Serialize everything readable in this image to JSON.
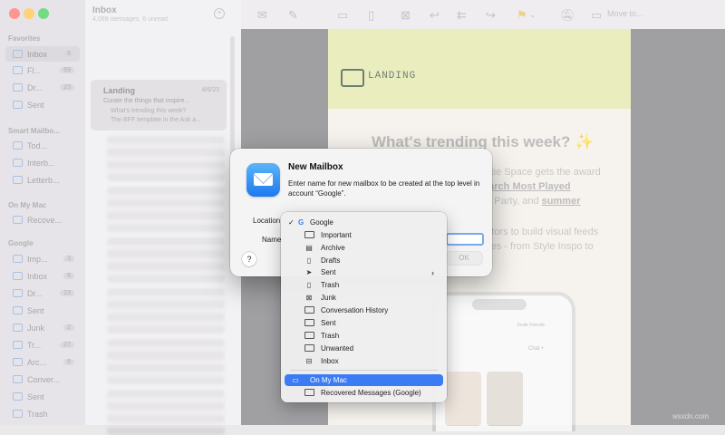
{
  "window": {
    "traffic_colors": [
      "#ff5f57",
      "#febc2e",
      "#28c840"
    ]
  },
  "sidebar": {
    "favorites_label": "Favorites",
    "smart_label": "Smart Mailbo...",
    "onmymac_label": "On My Mac",
    "google_label": "Google",
    "favorites": [
      {
        "label": "Inbox",
        "count": "6"
      },
      {
        "label": "Fl...",
        "count": "69"
      },
      {
        "label": "Dr...",
        "count": "23"
      },
      {
        "label": "Sent",
        "count": ""
      }
    ],
    "smart": [
      {
        "label": "Tod..."
      },
      {
        "label": "Interb..."
      },
      {
        "label": "Letterb..."
      }
    ],
    "onmymac": [
      {
        "label": "Recove..."
      }
    ],
    "google": [
      {
        "label": "Imp...",
        "count": "3"
      },
      {
        "label": "Inbox",
        "count": "6"
      },
      {
        "label": "Dr...",
        "count": "23"
      },
      {
        "label": "Sent",
        "count": ""
      },
      {
        "label": "Junk",
        "count": "2"
      },
      {
        "label": "Tr...",
        "count": "27"
      },
      {
        "label": "Arc...",
        "count": "6"
      },
      {
        "label": "Conver...",
        "count": ""
      },
      {
        "label": "Sent",
        "count": ""
      },
      {
        "label": "Trash",
        "count": ""
      }
    ]
  },
  "message_list": {
    "title": "Inbox",
    "subtitle": "4,069 messages, 6 unread",
    "selected": {
      "sender": "Landing",
      "date": "4/6/23",
      "subject": "Curate the things that inspire...",
      "preview1": "What's trending this week?",
      "preview2": "The BFF template in the Ask a..."
    }
  },
  "toolbar": {
    "move_to": "Move to..."
  },
  "email": {
    "brand": "LANDING",
    "headline": "What's trending this week? ✨",
    "body1a": "estie Space gets the award",
    "body1b": "March Most Played",
    "body1c": "ng Party, and ",
    "body1d": "summer",
    "body2a": "eators to build visual feeds",
    "body2b": "ches - from Style Inspo to",
    "phone_invite": "Invite Friends",
    "phone_chat": "Chat •",
    "banner_color": "#dfe49a"
  },
  "dialog": {
    "title": "New Mailbox",
    "message": "Enter name for new mailbox to be created at the top level in account “Google”.",
    "location_label": "Location",
    "name_label": "Name",
    "name_value": "",
    "ok_label": "OK",
    "help_label": "?"
  },
  "location_menu": {
    "account": "Google",
    "items": [
      {
        "label": "Important",
        "icon": "folder-icon"
      },
      {
        "label": "Archive",
        "icon": "archive-icon"
      },
      {
        "label": "Drafts",
        "icon": "drafts-icon"
      },
      {
        "label": "Sent",
        "icon": "sent-icon"
      },
      {
        "label": "Trash",
        "icon": "trash-icon"
      },
      {
        "label": "Junk",
        "icon": "junk-icon"
      },
      {
        "label": "Conversation History",
        "icon": "folder-icon"
      },
      {
        "label": "Sent",
        "icon": "folder-icon"
      },
      {
        "label": "Trash",
        "icon": "folder-icon"
      },
      {
        "label": "Unwanted",
        "icon": "folder-icon"
      },
      {
        "label": "Inbox",
        "icon": "inbox-icon"
      }
    ],
    "onmymac": "On My Mac",
    "recovered": "Recovered Messages (Google)",
    "selected_color": "#3b7cf5"
  },
  "watermark": "wsxdn.com"
}
